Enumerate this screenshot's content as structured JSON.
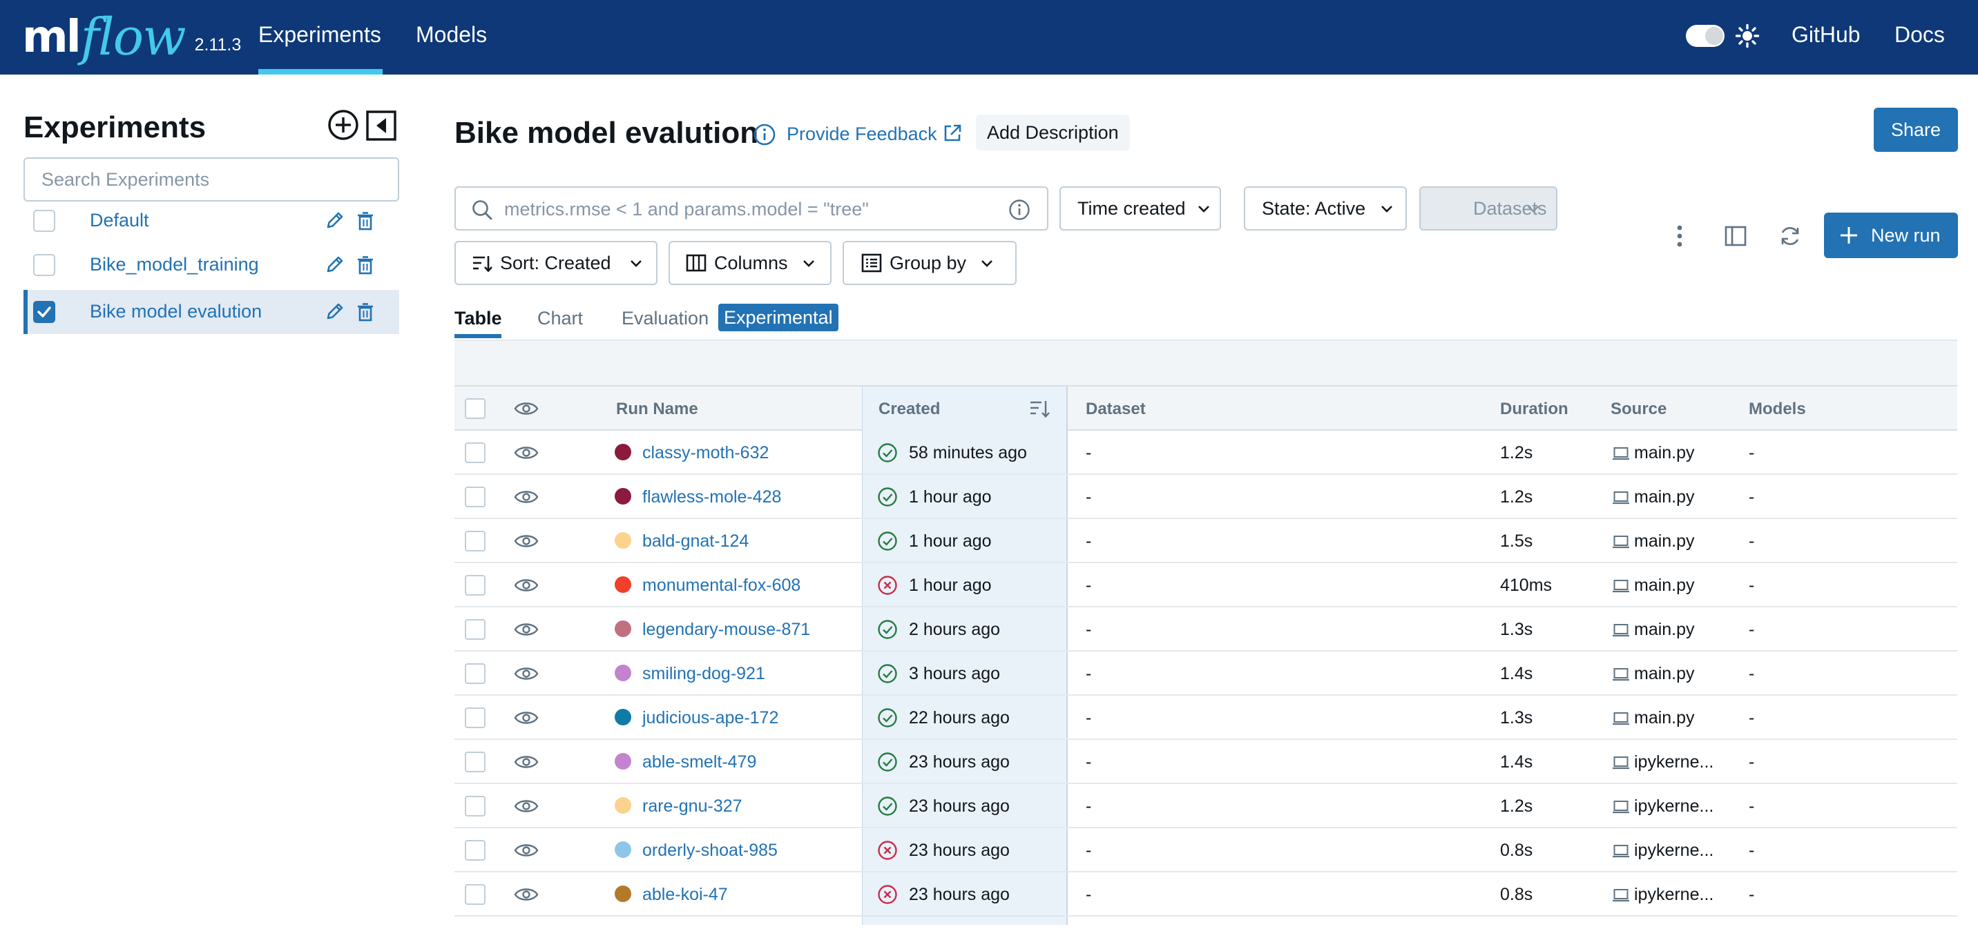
{
  "nav": {
    "logo_ml": "ml",
    "logo_flow": "flow",
    "version": "2.11.3",
    "experiments": "Experiments",
    "models": "Models",
    "github": "GitHub",
    "docs": "Docs"
  },
  "sidebar": {
    "title": "Experiments",
    "search_placeholder": "Search Experiments",
    "items": [
      {
        "label": "Default",
        "checked": false
      },
      {
        "label": "Bike_model_training",
        "checked": false
      },
      {
        "label": "Bike model evalution",
        "checked": true
      }
    ]
  },
  "header": {
    "title": "Bike model evalution",
    "feedback": "Provide Feedback",
    "add_description": "Add Description",
    "share": "Share"
  },
  "controls": {
    "search_placeholder": "metrics.rmse < 1 and params.model = \"tree\"",
    "time_created": "Time created",
    "state": "State: Active",
    "datasets": "Datasets",
    "sort": "Sort: Created",
    "columns": "Columns",
    "group_by": "Group by",
    "new_run": "New run"
  },
  "tabs": {
    "table": "Table",
    "chart": "Chart",
    "evaluation": "Evaluation",
    "experimental": "Experimental"
  },
  "table": {
    "headers": {
      "run_name": "Run Name",
      "created": "Created",
      "dataset": "Dataset",
      "duration": "Duration",
      "source": "Source",
      "models": "Models"
    },
    "rows": [
      {
        "name": "classy-moth-632",
        "color": "#8b1a3c",
        "status": "success",
        "created": "58 minutes ago",
        "dataset": "-",
        "duration": "1.2s",
        "source": "main.py",
        "models": "-"
      },
      {
        "name": "flawless-mole-428",
        "color": "#8b1a3c",
        "status": "success",
        "created": "1 hour ago",
        "dataset": "-",
        "duration": "1.2s",
        "source": "main.py",
        "models": "-"
      },
      {
        "name": "bald-gnat-124",
        "color": "#fbd38d",
        "status": "success",
        "created": "1 hour ago",
        "dataset": "-",
        "duration": "1.5s",
        "source": "main.py",
        "models": "-"
      },
      {
        "name": "monumental-fox-608",
        "color": "#f0402a",
        "status": "failed",
        "created": "1 hour ago",
        "dataset": "-",
        "duration": "410ms",
        "source": "main.py",
        "models": "-"
      },
      {
        "name": "legendary-mouse-871",
        "color": "#c0707f",
        "status": "success",
        "created": "2 hours ago",
        "dataset": "-",
        "duration": "1.3s",
        "source": "main.py",
        "models": "-"
      },
      {
        "name": "smiling-dog-921",
        "color": "#c383cf",
        "status": "success",
        "created": "3 hours ago",
        "dataset": "-",
        "duration": "1.4s",
        "source": "main.py",
        "models": "-"
      },
      {
        "name": "judicious-ape-172",
        "color": "#0f7ba7",
        "status": "success",
        "created": "22 hours ago",
        "dataset": "-",
        "duration": "1.3s",
        "source": "main.py",
        "models": "-"
      },
      {
        "name": "able-smelt-479",
        "color": "#c383cf",
        "status": "success",
        "created": "23 hours ago",
        "dataset": "-",
        "duration": "1.4s",
        "source": "ipykerne...",
        "models": "-"
      },
      {
        "name": "rare-gnu-327",
        "color": "#fbd38d",
        "status": "success",
        "created": "23 hours ago",
        "dataset": "-",
        "duration": "1.2s",
        "source": "ipykerne...",
        "models": "-"
      },
      {
        "name": "orderly-shoat-985",
        "color": "#8ec6ea",
        "status": "failed",
        "created": "23 hours ago",
        "dataset": "-",
        "duration": "0.8s",
        "source": "ipykerne...",
        "models": "-"
      },
      {
        "name": "able-koi-47",
        "color": "#b5792a",
        "status": "failed",
        "created": "23 hours ago",
        "dataset": "-",
        "duration": "0.8s",
        "source": "ipykerne...",
        "models": "-"
      }
    ]
  },
  "colors": {
    "nav_bg": "#0e3877",
    "accent": "#43c9ed",
    "primary": "#2272b4",
    "success": "#277c43",
    "error": "#c82d4c"
  }
}
